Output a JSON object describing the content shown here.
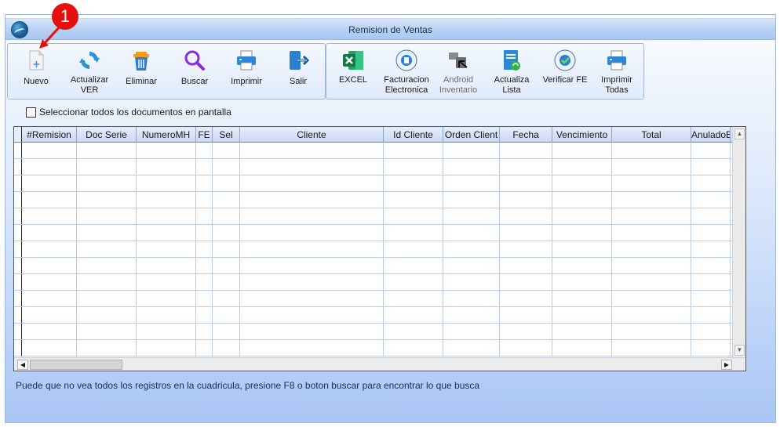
{
  "window": {
    "title": "Remision de Ventas"
  },
  "toolbar": {
    "left_group": [
      {
        "id": "nuevo",
        "label": "Nuevo",
        "icon": "new-document-icon"
      },
      {
        "id": "actualizar",
        "label": "Actualizar\nVER",
        "icon": "refresh-icon"
      },
      {
        "id": "eliminar",
        "label": "Eliminar",
        "icon": "trash-icon"
      },
      {
        "id": "buscar",
        "label": "Buscar",
        "icon": "search-icon"
      },
      {
        "id": "imprimir",
        "label": "Imprimir",
        "icon": "printer-icon"
      },
      {
        "id": "salir",
        "label": "Salir",
        "icon": "exit-icon"
      }
    ],
    "right_group": [
      {
        "id": "excel",
        "label": "EXCEL",
        "icon": "excel-icon"
      },
      {
        "id": "facturacion",
        "label": "Facturacion\nElectronica",
        "icon": "e-invoice-seal-icon"
      },
      {
        "id": "android",
        "label": "Android\nInventario",
        "icon": "android-inventory-icon",
        "disabled": true
      },
      {
        "id": "actualiza_lista",
        "label": "Actualiza\nLista",
        "icon": "update-list-icon"
      },
      {
        "id": "verificar",
        "label": "Verificar FE",
        "icon": "verify-e-invoice-icon"
      },
      {
        "id": "imprimir_todas",
        "label": "Imprimir\nTodas",
        "icon": "printer-all-icon"
      }
    ]
  },
  "select_all": {
    "label": "Seleccionar todos los documentos en pantalla",
    "checked": false
  },
  "grid": {
    "columns": [
      "#Remision",
      "Doc Serie",
      "NumeroMH",
      "FE",
      "Sel",
      "Cliente",
      "Id Cliente",
      "Orden Client",
      "Fecha",
      "Vencimiento",
      "Total",
      "AnuladoE"
    ],
    "rows": [],
    "empty_row_count": 13
  },
  "hint": "Puede que no vea todos los registros en la cuadricula, presione F8 o boton buscar para encontrar lo que busca",
  "annotation": {
    "number": "1"
  },
  "colors": {
    "accent_red": "#e60f0f",
    "title_text": "#1d2f50",
    "window_gradient_bottom": "#a9c6f6"
  }
}
